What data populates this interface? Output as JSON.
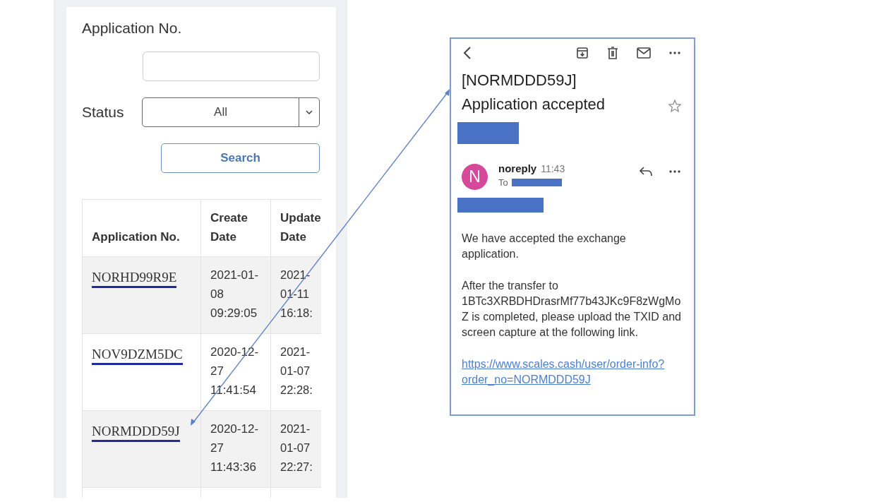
{
  "filter": {
    "application_no_label": "Application No.",
    "status_label": "Status",
    "status_value": "All",
    "search_button": "Search"
  },
  "table": {
    "columns": [
      "Application No.",
      "Create Date",
      "Update Date"
    ],
    "rows": [
      {
        "application_no": "NORHD99R9E",
        "create_date": "2021-01-08 09:29:05",
        "update_date": "2021-01-11 16:18:"
      },
      {
        "application_no": "NOV9DZM5DC",
        "create_date": "2020-12-27 11:41:54",
        "update_date": "2021-01-07 22:28:"
      },
      {
        "application_no": "NORMDDD59J",
        "create_date": "2020-12-27 11:43:36",
        "update_date": "2021-01-07 22:27:"
      }
    ]
  },
  "email": {
    "subject": "[NORMDDD59J] Application accepted",
    "starred": false,
    "avatar_letter": "N",
    "sender": "noreply",
    "time": "11:43",
    "to_label": "To",
    "paragraphs": [
      "We have accepted the exchange application.",
      "After the transfer to 1BTc3XRBDHDrasrMf77b43JKc9F8zWgMoZ is completed, please upload the TXID and screen capture at the following link."
    ],
    "link": "https://www.scales.cash/user/order-info?order_no=NORMDDD59J"
  }
}
